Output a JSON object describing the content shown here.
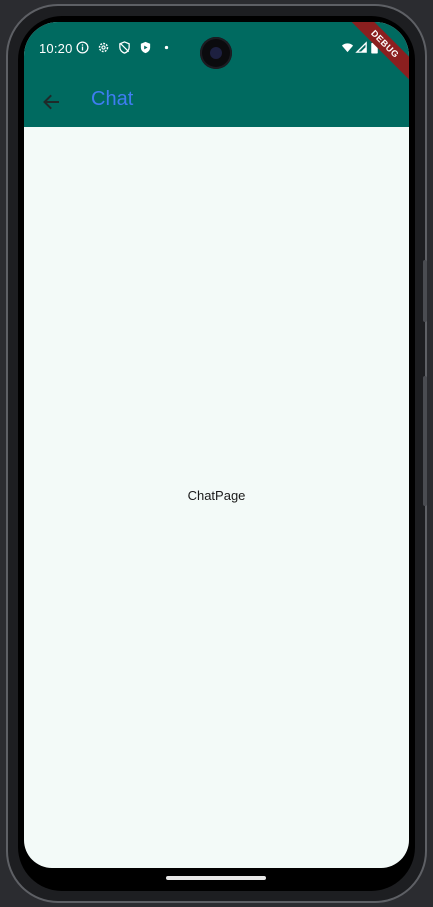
{
  "status_bar": {
    "time": "10:20",
    "left_icons": [
      "info-icon",
      "settings-icon",
      "shield-icon",
      "play-protect-icon",
      "dot-icon"
    ],
    "right_icons": [
      "wifi-icon",
      "signal-icon",
      "battery-icon"
    ]
  },
  "debug_banner": "DEBUG",
  "app_bar": {
    "title": "Chat",
    "back_icon": "arrow-back-icon"
  },
  "body": {
    "text": "ChatPage"
  },
  "colors": {
    "app_bar_bg": "#006a60",
    "title_color": "#3f7df2",
    "screen_bg": "#f3faf8",
    "debug_ribbon": "#8b1f1f"
  }
}
